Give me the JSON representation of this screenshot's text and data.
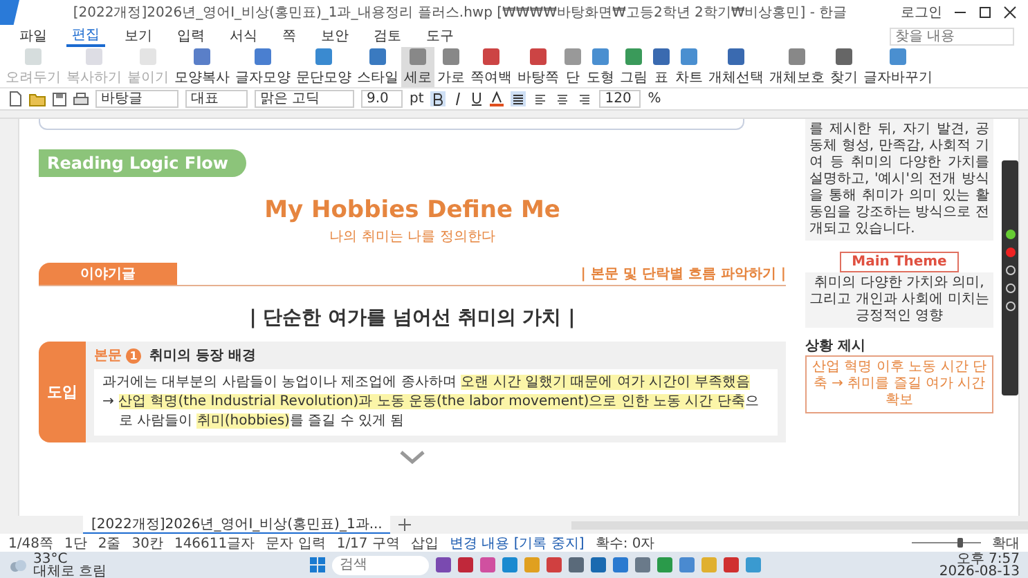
{
  "window": {
    "title": "[2022개정]2026년_영어I_비상(홍민표)_1과_내용정리 플러스.hwp [₩₩₩₩바탕화면₩고등2학년 2학기₩비상홍민] - 한글",
    "login": "로그인"
  },
  "menu": [
    {
      "label": "파일",
      "selected": false
    },
    {
      "label": "편집",
      "selected": true
    },
    {
      "label": "보기",
      "selected": false
    },
    {
      "label": "입력",
      "selected": false
    },
    {
      "label": "서식",
      "selected": false
    },
    {
      "label": "쪽",
      "selected": false
    },
    {
      "label": "보안",
      "selected": false
    },
    {
      "label": "검토",
      "selected": false
    },
    {
      "label": "도구",
      "selected": false
    }
  ],
  "search_box": {
    "placeholder": "찾을 내용"
  },
  "ribbon": [
    {
      "label": "오려두기",
      "disabled": true,
      "selected": false
    },
    {
      "label": "복사하기",
      "disabled": true,
      "selected": false
    },
    {
      "label": "붙이기",
      "disabled": true,
      "selected": false
    },
    {
      "label": "모양복사",
      "disabled": false,
      "selected": false
    },
    {
      "label": "글자모양",
      "disabled": false,
      "selected": false
    },
    {
      "label": "문단모양",
      "disabled": false,
      "selected": false
    },
    {
      "label": "스타일",
      "disabled": false,
      "selected": false
    },
    {
      "label": "세로",
      "disabled": false,
      "selected": true
    },
    {
      "label": "가로",
      "disabled": false,
      "selected": false
    },
    {
      "label": "쪽여백",
      "disabled": false,
      "selected": false
    },
    {
      "label": "바탕쪽",
      "disabled": false,
      "selected": false
    },
    {
      "label": "단",
      "disabled": false,
      "selected": false
    },
    {
      "label": "도형",
      "disabled": false,
      "selected": false
    },
    {
      "label": "그림",
      "disabled": false,
      "selected": false
    },
    {
      "label": "표",
      "disabled": false,
      "selected": false
    },
    {
      "label": "차트",
      "disabled": false,
      "selected": false
    },
    {
      "label": "개체선택",
      "disabled": false,
      "selected": false
    },
    {
      "label": "개체보호",
      "disabled": false,
      "selected": false
    },
    {
      "label": "찾기",
      "disabled": false,
      "selected": false
    },
    {
      "label": "글자바꾸기",
      "disabled": false,
      "selected": false
    }
  ],
  "format_bar": {
    "style": "바탕글",
    "language": "대표",
    "font": "맑은 고딕",
    "size": "9.0",
    "unit": "pt",
    "zoom": "120",
    "zoom_unit": "%"
  },
  "document": {
    "badge": "Reading Logic Flow",
    "title": "My Hobbies Define Me",
    "subtitle": "나의 취미는 나를 정의한다",
    "section_tab": "이야기글",
    "section_hint": "|  본문 및 단락별 흐름 파악하기 |",
    "heading": "| 단순한 여가를 넘어선 취미의 가치 |",
    "block": {
      "tag": "도입",
      "label": "본문",
      "number": "1",
      "label_title": "취미의 등장 배경",
      "lines": [
        [
          {
            "text": "과거에는 대부분의 사람들이 농업이나 제조업에 종사하며 ",
            "highlight": false
          },
          {
            "text": "오랜 시간 일했기 때문에 여가 시간이 부족했음",
            "highlight": true
          }
        ],
        [
          {
            "text": "→ ",
            "highlight": false
          },
          {
            "text": "산업 혁명(the Industrial Revolution)과 노동 운동(the labor movement)으로 인한 노동 시간 단축",
            "highlight": true
          },
          {
            "text": "으로 사람들이 ",
            "highlight": false
          },
          {
            "text": "취미(hobbies)",
            "highlight": true
          },
          {
            "text": "를 즐길 수 있게 됨",
            "highlight": false
          }
        ]
      ]
    }
  },
  "right_panel": {
    "summary": "를 제시한 뒤, 자기 발견, 공동체 형성, 만족감, 사회적 기여 등 취미의 다양한 가치를 설명하고, '예시'의 전개 방식을 통해 취미가 의미 있는 활동임을 강조하는 방식으로 전개되고 있습니다.",
    "theme_button": "Main Theme",
    "theme": "취미의 다양한 가치와 의미, 그리고 개인과 사회에 미치는 긍정적인 영향",
    "situation_title": "상황 제시",
    "situation": "산업 혁명 이후 노동 시간 단축 → 취미를 즐길 여가 시간 확보"
  },
  "doc_tabs": [
    {
      "label": "[2022개정]2026년_영어I_비상(홍민표)_1과...",
      "selected": true
    }
  ],
  "status_bar": [
    "1/48쪽",
    "1단",
    "2줄",
    "30칸",
    "146611글자",
    "문자 입력",
    "1/17 구역",
    "삽입",
    "변경 내용 [기록 중지]",
    "확수: 0자"
  ],
  "zoom_label": "확대",
  "zoom_slider": {
    "level": 0.7
  },
  "taskbar": {
    "temperature": "33°C",
    "weather": "대체로 흐림",
    "search_placeholder": "검색",
    "time": "오후 7:57",
    "date": "2026-08-13"
  }
}
